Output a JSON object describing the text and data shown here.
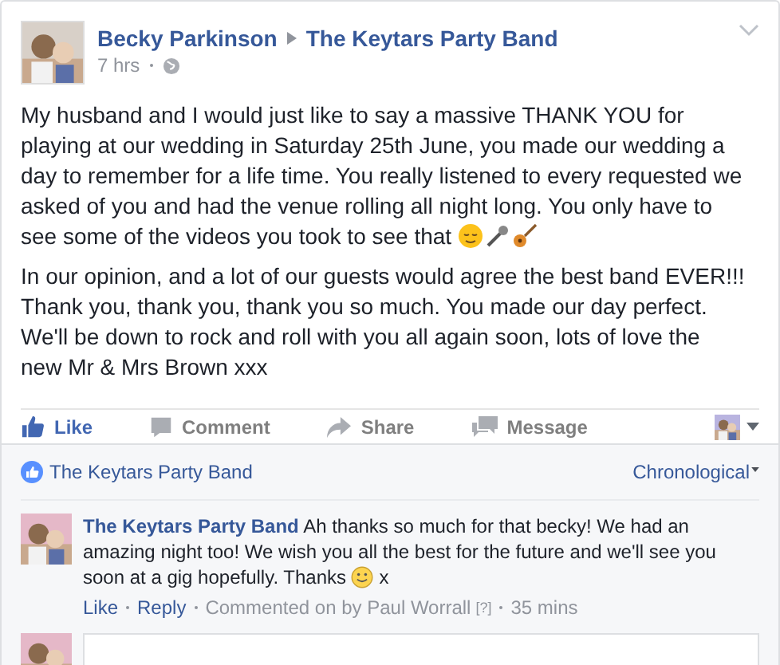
{
  "post": {
    "author": "Becky Parkinson",
    "target": "The Keytars Party Band",
    "time": "7 hrs",
    "paragraphs": [
      "My husband and I would just like to say a massive THANK YOU for playing at our wedding in Saturday 25th June, you made our wedding a day to remember for a life time. You really listened to every requested we asked of you and had the venue rolling all night long. You only have to see some of the videos you took to see that",
      "In our opinion, and a lot of our guests would agree the best band EVER!!! Thank you, thank you, thank you so much. You made our day perfect. We'll be down to rock and roll with you all again soon, lots of love the new Mr & Mrs Brown xxx"
    ]
  },
  "actions": [
    {
      "kind": "like",
      "label": "Like",
      "selected": true
    },
    {
      "kind": "comment",
      "label": "Comment",
      "selected": false
    },
    {
      "kind": "share",
      "label": "Share",
      "selected": false
    },
    {
      "kind": "message",
      "label": "Message",
      "selected": false
    }
  ],
  "likes": {
    "page": "The Keytars Party Band",
    "sort": "Chronological"
  },
  "comment": {
    "author": "The Keytars Party Band",
    "text": "Ah thanks so much for that becky! We had an amazing night too! We wish you all the best for the future and we'll see you soon at a gig hopefully. Thanks",
    "tail": "x",
    "links": [
      "Like",
      "Reply"
    ],
    "meta": "Commented on by Paul Worrall",
    "help": "[?]",
    "age": "35 mins"
  }
}
